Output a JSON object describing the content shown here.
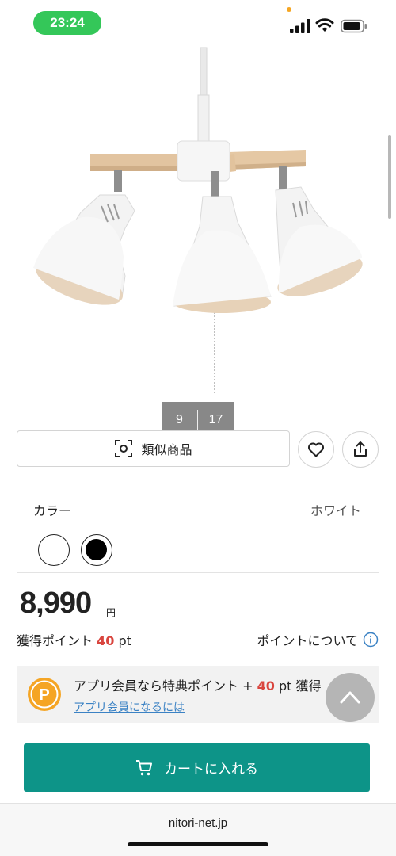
{
  "status_bar": {
    "time": "23:24"
  },
  "gallery": {
    "current": "9",
    "total": "17"
  },
  "actions": {
    "similar_label": "類似商品"
  },
  "color": {
    "label": "カラー",
    "selected": "ホワイト",
    "options": [
      "white",
      "black"
    ]
  },
  "price": {
    "amount": "8,990",
    "unit": "円"
  },
  "points": {
    "prefix": "獲得ポイント ",
    "value": "40",
    "suffix": " pt",
    "about_label": "ポイントについて"
  },
  "app_banner": {
    "text_prefix": "アプリ会員なら特典ポイント + ",
    "points": "40",
    "text_suffix": " pt 獲得",
    "link": "アプリ会員になるには"
  },
  "cart": {
    "label": "カートに入れる"
  },
  "browser": {
    "url": "nitori-net.jp"
  },
  "colors": {
    "accent": "#0d9488",
    "points_red": "#d9453e",
    "link_blue": "#3b82c4",
    "time_green": "#34c759"
  }
}
